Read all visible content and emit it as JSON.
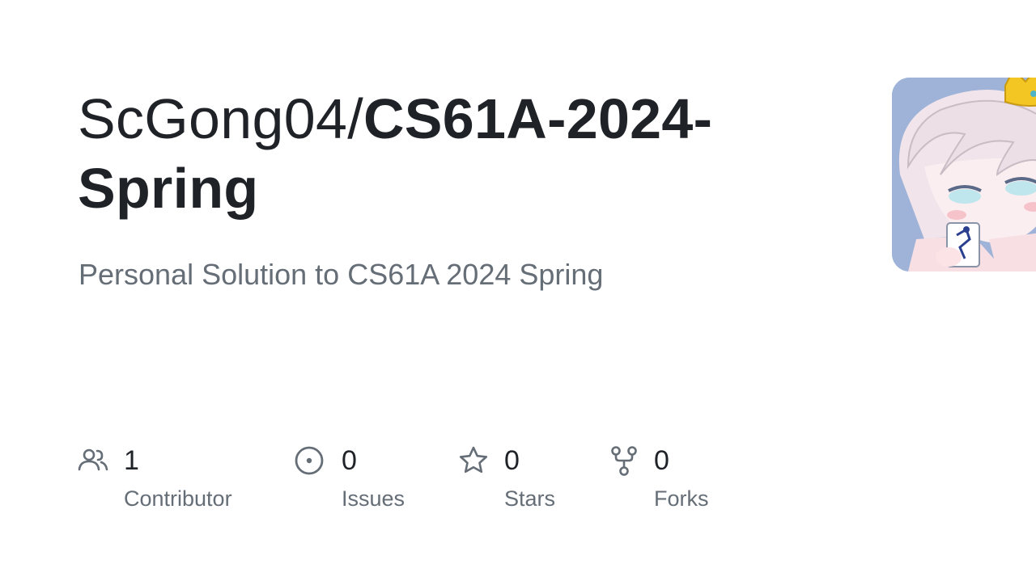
{
  "repo": {
    "owner": "ScGong04/",
    "name": "CS61A-2024-Spring",
    "description": "Personal Solution to CS61A 2024 Spring"
  },
  "stats": [
    {
      "icon": "people-icon",
      "value": "1",
      "label": "Contributor"
    },
    {
      "icon": "issue-opened-icon",
      "value": "0",
      "label": "Issues"
    },
    {
      "icon": "star-icon",
      "value": "0",
      "label": "Stars"
    },
    {
      "icon": "repo-forked-icon",
      "value": "0",
      "label": "Forks"
    }
  ],
  "colors": {
    "title": "#1f2328",
    "muted": "#656d76",
    "icon": "#656d76",
    "background": "#ffffff",
    "avatar_bg": "#9fb3d8",
    "avatar_crown": "#f3c623"
  }
}
